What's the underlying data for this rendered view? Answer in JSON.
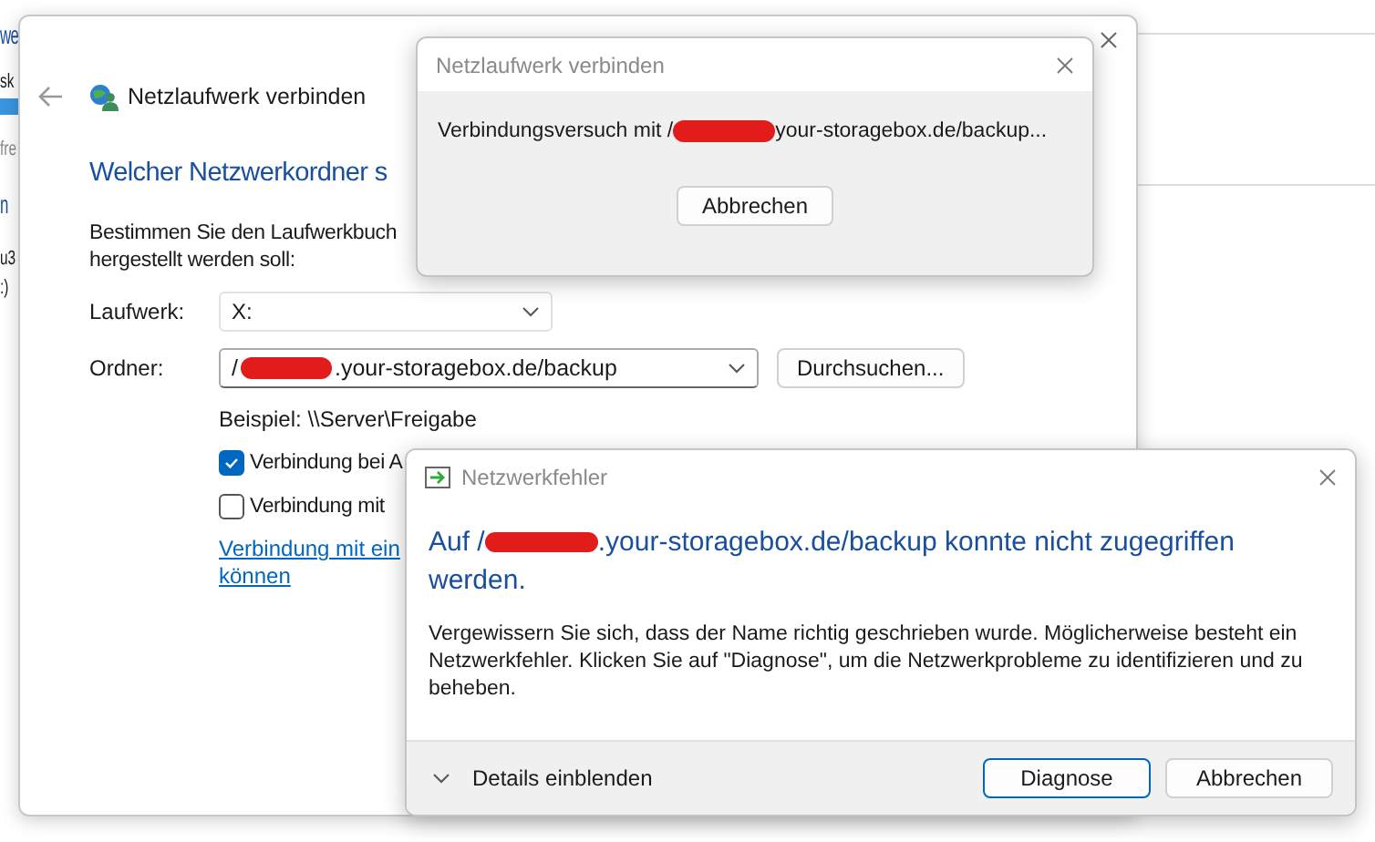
{
  "background_window": {
    "fragments": [
      {
        "text": "we",
        "kind": "large"
      },
      {
        "text": "sk",
        "kind": "normal"
      },
      {
        "text": "fre",
        "kind": "muted"
      },
      {
        "text": "n",
        "kind": "large"
      },
      {
        "text": "u3",
        "kind": "normal"
      },
      {
        "text": ":)",
        "kind": "normal"
      }
    ]
  },
  "wizard": {
    "title": "Netzlaufwerk verbinden",
    "heading": "Welcher Netzwerkordner s",
    "instruction_lines": [
      "Bestimmen Sie den Laufwerkbuch",
      "hergestellt werden soll:"
    ],
    "drive_label": "Laufwerk:",
    "drive_value": "X:",
    "folder_label": "Ordner:",
    "folder_value_prefix": "/",
    "folder_value": ".your-storagebox.de/backup",
    "browse_button": "Durchsuchen...",
    "example": "Beispiel: \\\\Server\\Freigabe",
    "checkboxes": [
      {
        "label": "Verbindung bei A",
        "checked": true
      },
      {
        "label": "Verbindung mit",
        "checked": false
      }
    ],
    "link_lines": [
      "Verbindung mit ein",
      "können"
    ]
  },
  "progress_dialog": {
    "title": "Netzlaufwerk verbinden",
    "message_prefix": "Verbindungsversuch mit /",
    "message_suffix": "your-storagebox.de/backup...",
    "cancel_button": "Abbrechen"
  },
  "error_dialog": {
    "title": "Netzwerkfehler",
    "heading_prefix": "Auf /",
    "heading_line1": ".your-storagebox.de/backup konnte nicht zugegriffen",
    "heading_line2": "werden.",
    "body": "Vergewissern Sie sich, dass der Name richtig geschrieben wurde. Möglicherweise besteht ein Netzwerkfehler. Klicken Sie auf \"Diagnose\", um die Netzwerkprobleme zu identifizieren und zu beheben.",
    "details_toggle": "Details einblenden",
    "buttons": [
      {
        "label": "Diagnose",
        "kind": "default"
      },
      {
        "label": "Abbrechen",
        "kind": "normal"
      }
    ]
  }
}
